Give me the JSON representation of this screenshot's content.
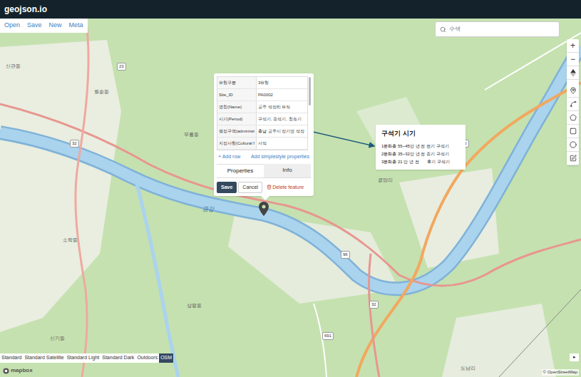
{
  "app": {
    "title": "geojson.io"
  },
  "menu": [
    {
      "label": "Open"
    },
    {
      "label": "Save"
    },
    {
      "label": "New"
    },
    {
      "label": "Meta"
    }
  ],
  "search": {
    "placeholder": "수색"
  },
  "controls": {
    "zoom_in": "+",
    "zoom_out": "−",
    "collapse": "▸"
  },
  "popup": {
    "rows": [
      {
        "key": "유형구분",
        "value": "3유형"
      },
      {
        "key": "Site_ID",
        "value": "PA0002"
      },
      {
        "key": "명칭(Name)",
        "value": "공주 석장리 유적"
      },
      {
        "key": "시기(Period)",
        "value": "구석기, 중석기, 청동기"
      },
      {
        "key": "행정구역(administr",
        "value": "충남 공주시 장기면 석장"
      },
      {
        "key": "지정사항(Cultural f",
        "value": "사적"
      }
    ],
    "add_row": "+ Add row",
    "add_simplestyle": "Add simplestyle properties",
    "tabs": [
      {
        "label": "Properties",
        "selected": true
      },
      {
        "label": "Info",
        "selected": false
      }
    ],
    "save": "Save",
    "cancel": "Cancel",
    "delete": "Delete feature"
  },
  "annotation": {
    "title": "구석기 시기",
    "lines": [
      "1분화층 55~45만 년 전 전기 구석기",
      "2분화층 35~32만 년 전 중기 구석기",
      "3분화층 21 만 년 전       후기 구석기"
    ]
  },
  "map_labels": [
    {
      "text": "신관동",
      "kind": "place"
    },
    {
      "text": "월송동",
      "kind": "place"
    },
    {
      "text": "무릉동",
      "kind": "place"
    },
    {
      "text": "소학동",
      "kind": "place"
    },
    {
      "text": "상왕동",
      "kind": "place"
    },
    {
      "text": "신기동",
      "kind": "place"
    },
    {
      "text": "공암리",
      "kind": "place"
    },
    {
      "text": "도남리",
      "kind": "place"
    },
    {
      "text": "금강",
      "kind": "river"
    },
    {
      "text": "23",
      "kind": "shield"
    },
    {
      "text": "32",
      "kind": "shield"
    },
    {
      "text": "32",
      "kind": "shield"
    },
    {
      "text": "96",
      "kind": "shield"
    },
    {
      "text": "96",
      "kind": "shield"
    },
    {
      "text": "691",
      "kind": "shield"
    }
  ],
  "layers": [
    {
      "label": "Standard",
      "selected": false
    },
    {
      "label": "Standard Satellite",
      "selected": false
    },
    {
      "label": "Standard Light",
      "selected": false
    },
    {
      "label": "Standard Dark",
      "selected": false
    },
    {
      "label": "Outdoors",
      "selected": false
    },
    {
      "label": "OSM",
      "selected": true
    }
  ],
  "attribution": {
    "logo": "mapbox",
    "credit": "© OpenStreetMap"
  }
}
